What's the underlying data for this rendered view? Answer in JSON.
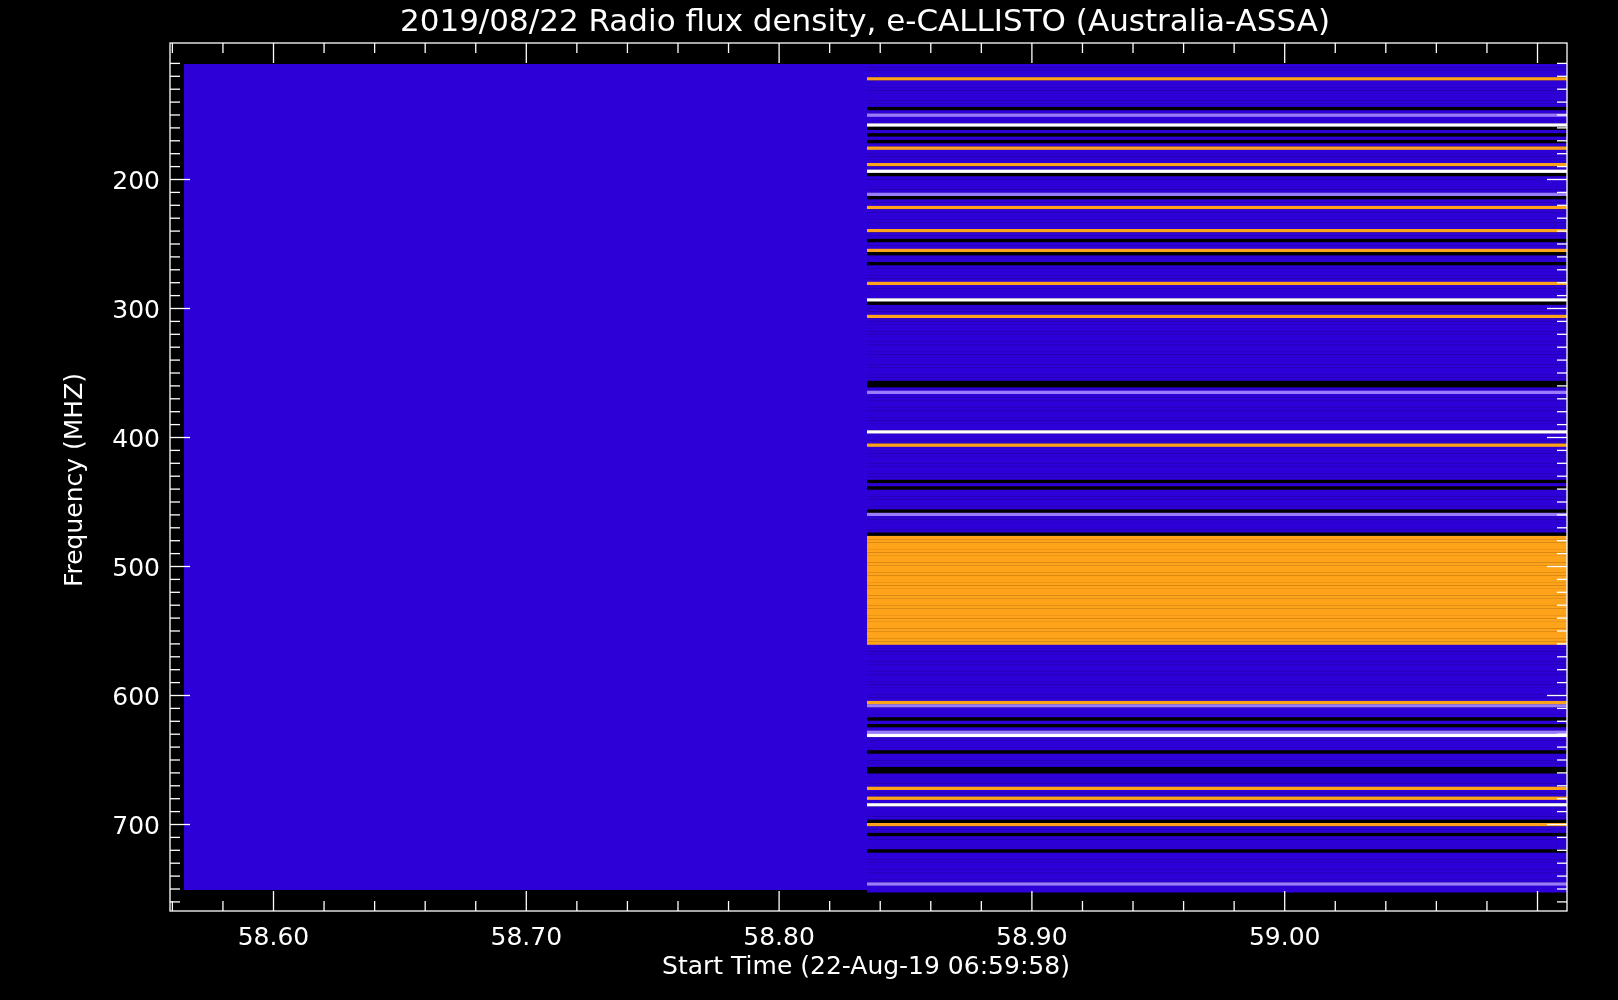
{
  "plot": {
    "title": "2019/08/22  Radio flux density, e-CALLISTO (Australia-ASSA)",
    "xlabel": "Start Time (22-Aug-19 06:59:58)",
    "ylabel": "Frequency (MHZ)",
    "xtick_labels": [
      "58.60",
      "58.70",
      "58.80",
      "58.90",
      "59.00"
    ],
    "ytick_labels": [
      "200",
      "300",
      "400",
      "500",
      "600",
      "700"
    ]
  }
}
